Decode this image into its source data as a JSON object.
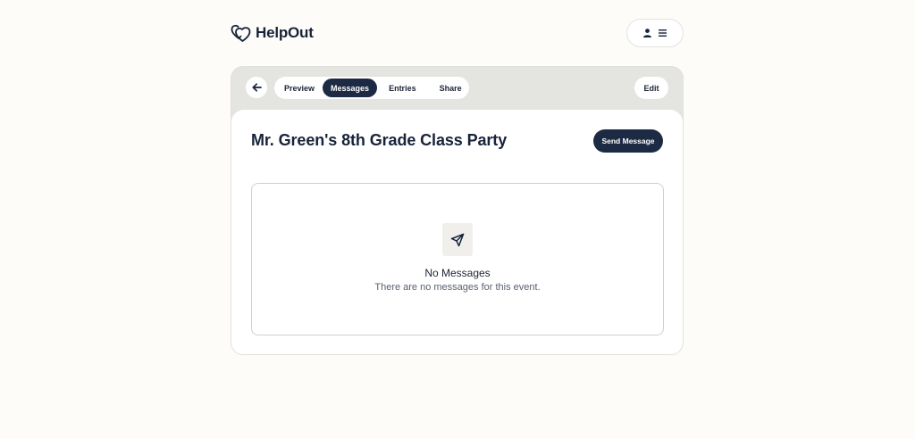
{
  "header": {
    "brand": "HelpOut",
    "logo_icon": "helpout-heart-logo-icon",
    "account_icon": "user-icon",
    "menu_icon": "hamburger-menu-icon"
  },
  "toolbar": {
    "back_icon": "arrow-left-icon",
    "tabs": [
      {
        "label": "Preview",
        "active": false
      },
      {
        "label": "Messages",
        "active": true
      },
      {
        "label": "Entries",
        "active": false
      },
      {
        "label": "Share",
        "active": false
      }
    ],
    "edit_label": "Edit"
  },
  "main": {
    "title": "Mr. Green's 8th Grade Class Party",
    "send_label": "Send Message",
    "empty_state": {
      "icon": "paper-plane-icon",
      "title": "No Messages",
      "subtitle": "There are no messages for this event."
    }
  },
  "colors": {
    "background": "#fdfcf8",
    "accent": "#1c2a44",
    "tabbar": "#e4e4e0"
  }
}
